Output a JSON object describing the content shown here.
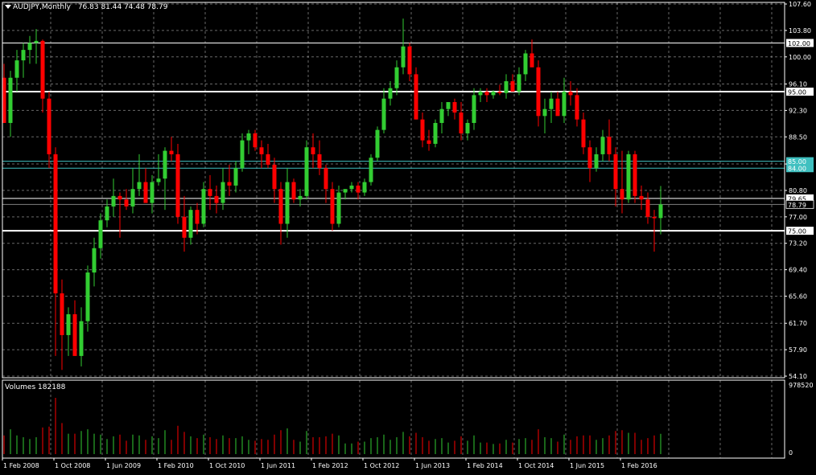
{
  "header": {
    "title": "AUDJPY,Monthly",
    "ohlc": "76.83 81.44 74.48 78.79",
    "volume_label": "Volumes 182188"
  },
  "colors": {
    "background": "#000000",
    "bull": "#32cd32",
    "bear": "#ff0000",
    "grid": "#c0c0c0",
    "hline": "#ffffff",
    "hline_cyan": "#40c0c0"
  },
  "chart_data": {
    "type": "candlestick",
    "timeframe": "Monthly",
    "ylim": [
      54.1,
      107.6
    ],
    "y_ticks": [
      "107.60",
      "103.80",
      "100.00",
      "96.10",
      "92.30",
      "88.50",
      "84.60",
      "80.80",
      "77.00",
      "73.20",
      "69.40",
      "65.60",
      "61.70",
      "57.90",
      "54.10"
    ],
    "x_ticks": [
      "1 Feb 2008",
      "1 Oct 2008",
      "1 Jun 2009",
      "1 Feb 2010",
      "1 Oct 2010",
      "1 Jun 2011",
      "1 Feb 2012",
      "1 Oct 2012",
      "1 Jun 2013",
      "1 Feb 2014",
      "1 Oct 2014",
      "1 Jun 2015",
      "1 Feb 2016"
    ],
    "horizontal_lines": [
      {
        "label": "102.00",
        "value": 102.0,
        "style": "white"
      },
      {
        "label": "95.00",
        "value": 95.0,
        "style": "white-thick"
      },
      {
        "label": "85.00",
        "value": 85.0,
        "style": "cyan"
      },
      {
        "label": "84.00",
        "value": 84.0,
        "style": "cyan"
      },
      {
        "label": "79.65",
        "value": 79.65,
        "style": "white"
      },
      {
        "label": "78.79",
        "value": 78.79,
        "style": "current"
      },
      {
        "label": "75.00",
        "value": 75.0,
        "style": "white-thick"
      }
    ],
    "candles": [
      [
        97,
        99,
        93,
        90.5
      ],
      [
        90.5,
        98,
        88.5,
        97
      ],
      [
        97,
        101,
        95,
        99.5
      ],
      [
        99.5,
        102,
        97,
        101
      ],
      [
        101,
        103,
        99,
        102
      ],
      [
        102,
        104,
        99,
        102.3
      ],
      [
        102.3,
        102.5,
        92,
        94
      ],
      [
        94,
        95,
        84,
        86
      ],
      [
        86,
        87,
        57,
        66
      ],
      [
        66,
        68,
        55,
        60
      ],
      [
        60,
        64,
        57,
        63
      ],
      [
        63,
        65,
        58,
        57
      ],
      [
        57,
        64,
        55.5,
        62
      ],
      [
        62,
        70,
        60.5,
        69
      ],
      [
        69,
        74,
        67,
        72.5
      ],
      [
        72.5,
        77.5,
        71,
        76.5
      ],
      [
        76.5,
        79.5,
        75.5,
        78.5
      ],
      [
        78.5,
        82.5,
        77,
        80
      ],
      [
        80,
        80.5,
        74,
        79.5
      ],
      [
        79.5,
        81,
        78,
        78.5
      ],
      [
        78.5,
        84,
        77.5,
        81
      ],
      [
        81,
        86,
        80,
        82
      ],
      [
        82,
        84,
        80.5,
        79
      ],
      [
        79,
        83,
        77.5,
        82
      ],
      [
        82,
        86,
        81.5,
        82.5
      ],
      [
        82.5,
        87,
        78,
        86.5
      ],
      [
        86.5,
        88.5,
        85,
        86
      ],
      [
        86,
        87.5,
        76,
        77
      ],
      [
        77,
        80,
        72,
        74
      ],
      [
        74,
        78.5,
        73,
        78
      ],
      [
        78,
        79,
        74.5,
        76
      ],
      [
        76,
        82,
        75.5,
        81
      ],
      [
        81,
        83,
        78,
        80
      ],
      [
        80,
        81.5,
        77.5,
        79
      ],
      [
        79,
        84,
        78,
        82
      ],
      [
        82,
        84.5,
        80,
        81.5
      ],
      [
        81.5,
        85,
        80.5,
        84
      ],
      [
        84,
        89,
        83.5,
        88
      ],
      [
        88,
        89.5,
        86,
        89
      ],
      [
        89,
        89.5,
        86.5,
        87
      ],
      [
        87,
        88,
        84,
        86
      ],
      [
        86,
        87.5,
        84,
        84.5
      ],
      [
        84.5,
        85.5,
        79,
        81
      ],
      [
        81,
        82,
        73,
        76
      ],
      [
        76,
        84,
        74,
        82
      ],
      [
        82,
        82.5,
        79,
        79.5
      ],
      [
        79.5,
        81,
        78.5,
        80
      ],
      [
        80,
        88,
        79.5,
        87
      ],
      [
        87,
        89,
        84,
        86
      ],
      [
        86,
        88,
        83,
        84
      ],
      [
        84,
        84.5,
        79,
        81
      ],
      [
        81,
        82,
        75,
        76
      ],
      [
        76,
        81.5,
        75.5,
        80.5
      ],
      [
        80.5,
        81,
        79.5,
        81
      ],
      [
        81,
        82,
        80.5,
        81.5
      ],
      [
        81.5,
        82,
        79.5,
        80.5
      ],
      [
        80.5,
        82.5,
        80,
        82
      ],
      [
        82,
        86,
        81.5,
        85.5
      ],
      [
        85.5,
        90,
        85,
        89.5
      ],
      [
        89.5,
        95.5,
        89,
        94
      ],
      [
        94,
        96.5,
        93,
        95.5
      ],
      [
        95.5,
        99.5,
        94.5,
        98.5
      ],
      [
        98.5,
        105.5,
        97.5,
        101.5
      ],
      [
        101.5,
        102,
        96.5,
        97.5
      ],
      [
        97.5,
        98.5,
        91,
        91
      ],
      [
        91,
        92,
        87,
        88
      ],
      [
        88,
        89.5,
        86.5,
        87.5
      ],
      [
        87.5,
        91,
        87,
        90.5
      ],
      [
        90.5,
        93.5,
        89,
        92.5
      ],
      [
        92.5,
        93.5,
        91.5,
        93.5
      ],
      [
        93.5,
        94,
        91,
        92
      ],
      [
        92,
        93.5,
        88,
        89
      ],
      [
        89,
        91,
        88,
        90.5
      ],
      [
        90.5,
        95.5,
        89.5,
        94.5
      ],
      [
        94.5,
        95.5,
        93.5,
        95
      ],
      [
        95,
        95.5,
        93.5,
        94.5
      ],
      [
        94.5,
        95.2,
        94,
        95
      ],
      [
        95,
        96,
        94.5,
        94.8
      ],
      [
        94.8,
        97.5,
        94,
        96.5
      ],
      [
        96.5,
        97.5,
        95.5,
        95
      ],
      [
        95,
        98.5,
        94.5,
        97.5
      ],
      [
        97.5,
        101,
        96.5,
        100.5
      ],
      [
        100.5,
        102.5,
        99,
        98.5
      ],
      [
        98.5,
        99.5,
        90,
        91.5
      ],
      [
        91.5,
        94,
        89,
        92.5
      ],
      [
        92.5,
        95,
        90.5,
        94
      ],
      [
        94,
        95,
        92.5,
        91.5
      ],
      [
        91.5,
        97,
        90.5,
        95
      ],
      [
        95,
        96.5,
        93,
        94.5
      ],
      [
        94.5,
        95.5,
        90,
        91
      ],
      [
        91,
        92,
        86,
        87
      ],
      [
        87,
        88,
        82,
        84
      ],
      [
        84,
        87,
        83.5,
        86
      ],
      [
        86,
        89.5,
        85,
        88.5
      ],
      [
        88.5,
        91,
        85,
        86
      ],
      [
        86,
        87,
        78.5,
        81
      ],
      [
        81,
        86.5,
        77.5,
        79.5
      ],
      [
        79.5,
        86.5,
        79,
        86
      ],
      [
        86,
        86.5,
        79,
        80
      ],
      [
        80,
        81.5,
        78,
        79.5
      ],
      [
        79.5,
        80.5,
        76,
        77
      ],
      [
        77,
        78,
        72,
        76.8
      ],
      [
        76.83,
        81.44,
        74.48,
        78.79
      ]
    ],
    "volume_axis": [
      "978520",
      "0"
    ]
  }
}
